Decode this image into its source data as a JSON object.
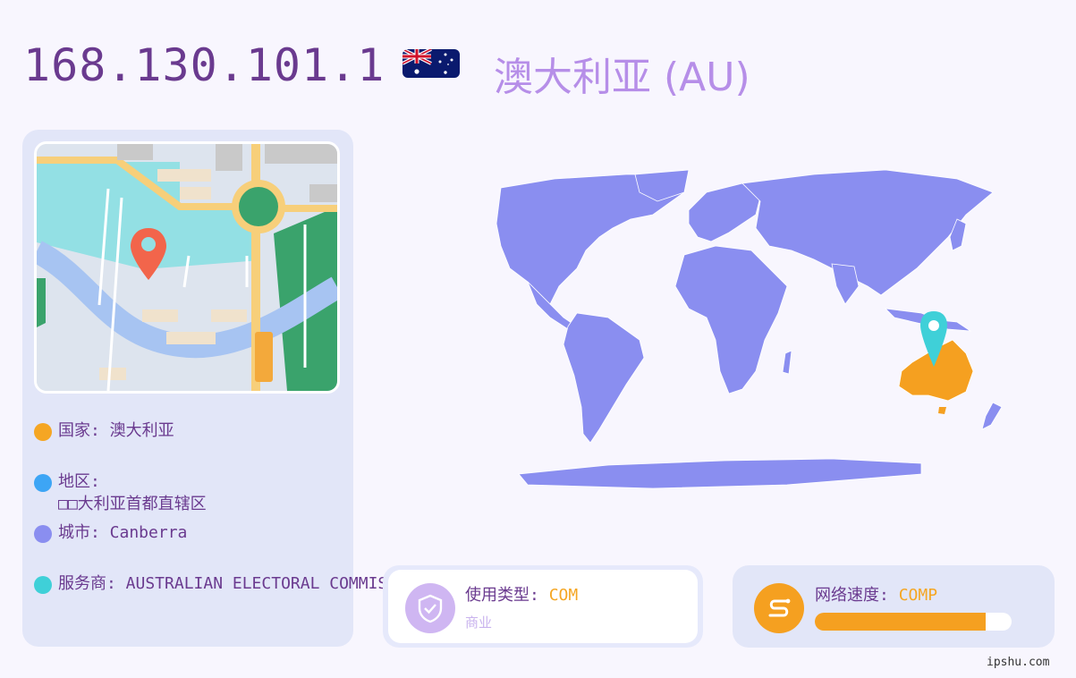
{
  "header": {
    "ip": "168.130.101.1",
    "country_title": "澳大利亚 (AU)"
  },
  "info": {
    "country": "国家: 澳大利亚",
    "region_label": "地区:",
    "region_value": "□□大利亚首都直辖区",
    "city": "城市: Canberra",
    "isp": "服务商: AUSTRALIAN ELECTORAL COMMISSION"
  },
  "usage": {
    "label": "使用类型: ",
    "value": "COM",
    "sub": "商业"
  },
  "speed": {
    "label": "网络速度: ",
    "value": "COMP",
    "progress": 0.87
  },
  "footer": "ipshu.com",
  "colors": {
    "accent_orange": "#f5a623",
    "dot_country": "#f5a623",
    "dot_region": "#3da5f5",
    "dot_city": "#8a8ef0",
    "dot_isp": "#3fd0d8",
    "world_land": "#8a8ef0",
    "highlight": "#f5a020"
  }
}
